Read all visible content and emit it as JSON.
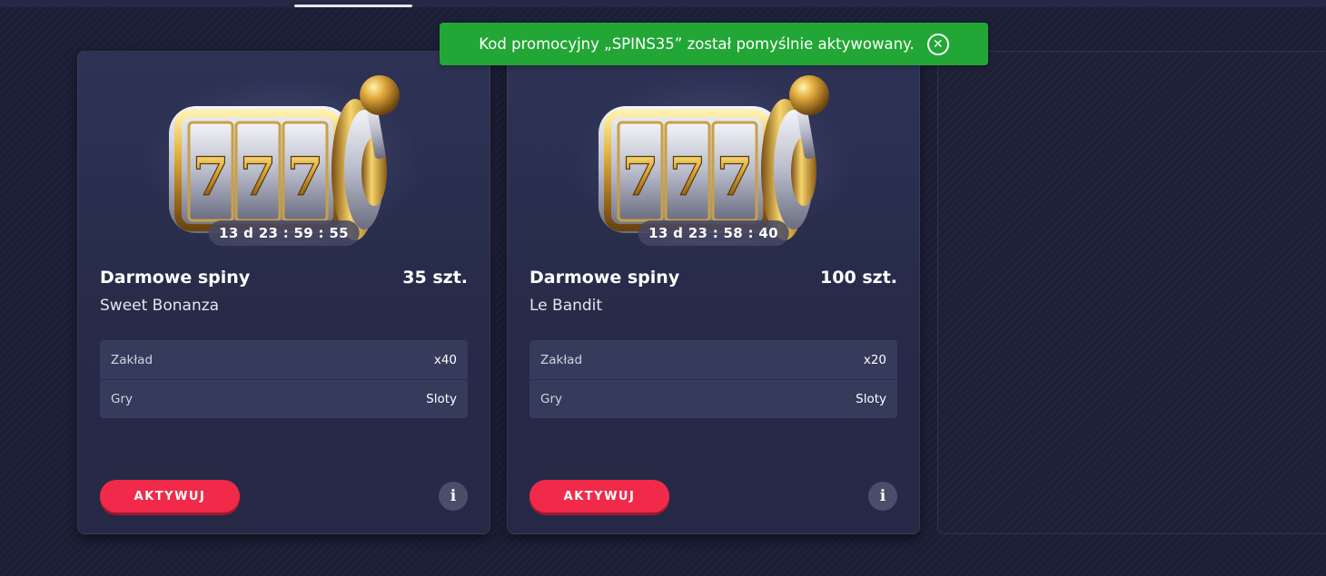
{
  "toast": {
    "message": "Kod promocyjny „SPINS35” został pomyślnie aktywowany.",
    "close_icon": "close-circle-icon",
    "color": "#22a736"
  },
  "cards": [
    {
      "timer": "13 d 23 : 59 : 55",
      "title": "Darmowe spiny",
      "quantity": "35 szt.",
      "game": "Sweet Bonanza",
      "details": [
        {
          "label": "Zakład",
          "value": "x40"
        },
        {
          "label": "Gry",
          "value": "Sloty"
        }
      ],
      "activate_label": "AKTYWUJ",
      "info_label": "i"
    },
    {
      "timer": "13 d 23 : 58 : 40",
      "title": "Darmowe spiny",
      "quantity": "100 szt.",
      "game": "Le Bandit",
      "details": [
        {
          "label": "Zakład",
          "value": "x20"
        },
        {
          "label": "Gry",
          "value": "Sloty"
        }
      ],
      "activate_label": "AKTYWUJ",
      "info_label": "i"
    }
  ],
  "colors": {
    "accent": "#f12a49",
    "success": "#22a736",
    "card_bg": "#2e3356",
    "page_bg": "#1c1e35"
  },
  "icons": {
    "slot_machine": "slot-machine-777-icon",
    "info": "info-icon"
  }
}
